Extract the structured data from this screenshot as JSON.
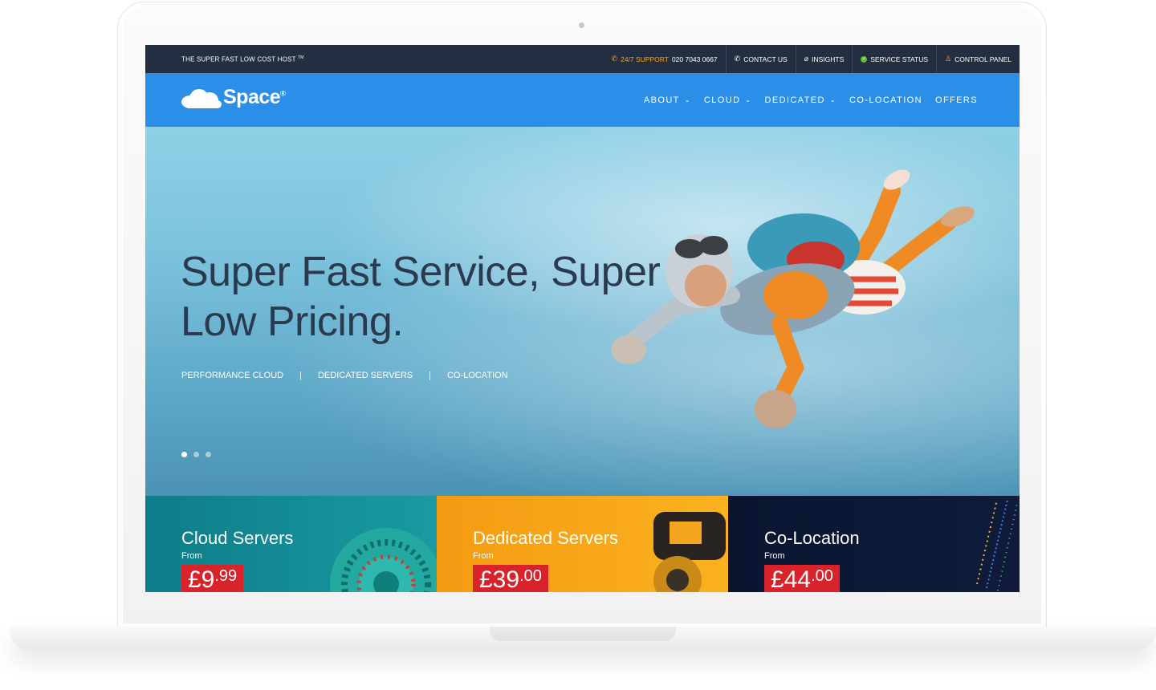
{
  "topbar": {
    "tagline": "THE SUPER FAST LOW COST HOST",
    "tagline_tm": "TM",
    "support_label": "24/7 SUPPORT",
    "support_phone": "020 7043 0667",
    "contact": "CONTACT US",
    "insights": "INSIGHTS",
    "service_status": "SERVICE STATUS",
    "control_panel": "CONTROL PANEL"
  },
  "nav": {
    "logo_text": "Space",
    "logo_mark": "®",
    "items": [
      {
        "label": "ABOUT",
        "dropdown": true
      },
      {
        "label": "CLOUD",
        "dropdown": true
      },
      {
        "label": "DEDICATED",
        "dropdown": true
      },
      {
        "label": "CO-LOCATION",
        "dropdown": false
      },
      {
        "label": "OFFERS",
        "dropdown": false
      }
    ]
  },
  "hero": {
    "title_line1": "Super Fast Service, Super",
    "title_line2": "Low Pricing.",
    "links": [
      "PERFORMANCE CLOUD",
      "DEDICATED SERVERS",
      "CO-LOCATION"
    ],
    "separator": "|",
    "slides": 3,
    "active_slide": 1
  },
  "tiles": [
    {
      "title": "Cloud Servers",
      "from": "From",
      "price_main": "£9",
      "price_cents": ".99"
    },
    {
      "title": "Dedicated Servers",
      "from": "From",
      "price_main": "£39",
      "price_cents": ".00"
    },
    {
      "title": "Co-Location",
      "from": "From",
      "price_main": "£44",
      "price_cents": ".00"
    }
  ],
  "colors": {
    "nav_blue": "#2b8fe8",
    "topbar": "#232f40",
    "accent_orange": "#f5a623",
    "price_red": "#d9232a"
  }
}
